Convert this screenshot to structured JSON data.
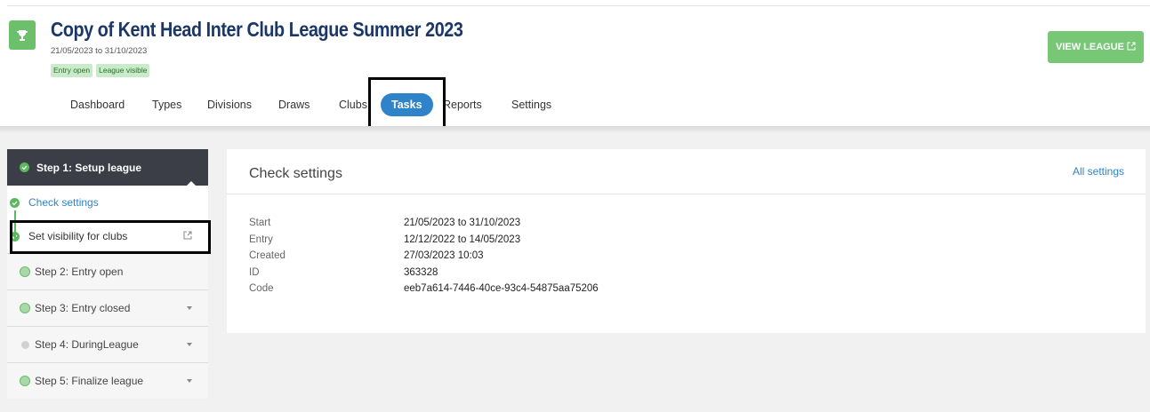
{
  "header": {
    "title": "Copy of Kent Head Inter Club League Summer 2023",
    "dates": "21/05/2023 to 31/10/2023",
    "badges": [
      "Entry open",
      "League visible"
    ],
    "view_button": "VIEW LEAGUE"
  },
  "nav": {
    "items": [
      "Dashboard",
      "Types",
      "Divisions",
      "Draws",
      "Clubs",
      "Tasks",
      "Reports",
      "Settings"
    ],
    "active": "Tasks"
  },
  "sidebar": {
    "step1": "Step 1: Setup league",
    "tasks": [
      "Check settings",
      "Set visibility for clubs"
    ],
    "steps": [
      "Step 2: Entry open",
      "Step 3: Entry closed",
      "Step 4: DuringLeague",
      "Step 5: Finalize league"
    ]
  },
  "main": {
    "title": "Check settings",
    "link": "All settings",
    "properties": [
      {
        "key": "Start",
        "value": "21/05/2023 to 31/10/2023"
      },
      {
        "key": "Entry",
        "value": "12/12/2022 to 14/05/2023"
      },
      {
        "key": "Created",
        "value": "27/03/2023 10:03"
      },
      {
        "key": "ID",
        "value": "363328"
      },
      {
        "key": "Code",
        "value": "eeb7a614-7446-40ce-93c4-54875aa75206"
      }
    ]
  },
  "colors": {
    "brand_green": "#6cc06c",
    "title_navy": "#1b3768",
    "accent_blue": "#2f83c8",
    "sidebar_dark": "#3b3e46"
  }
}
